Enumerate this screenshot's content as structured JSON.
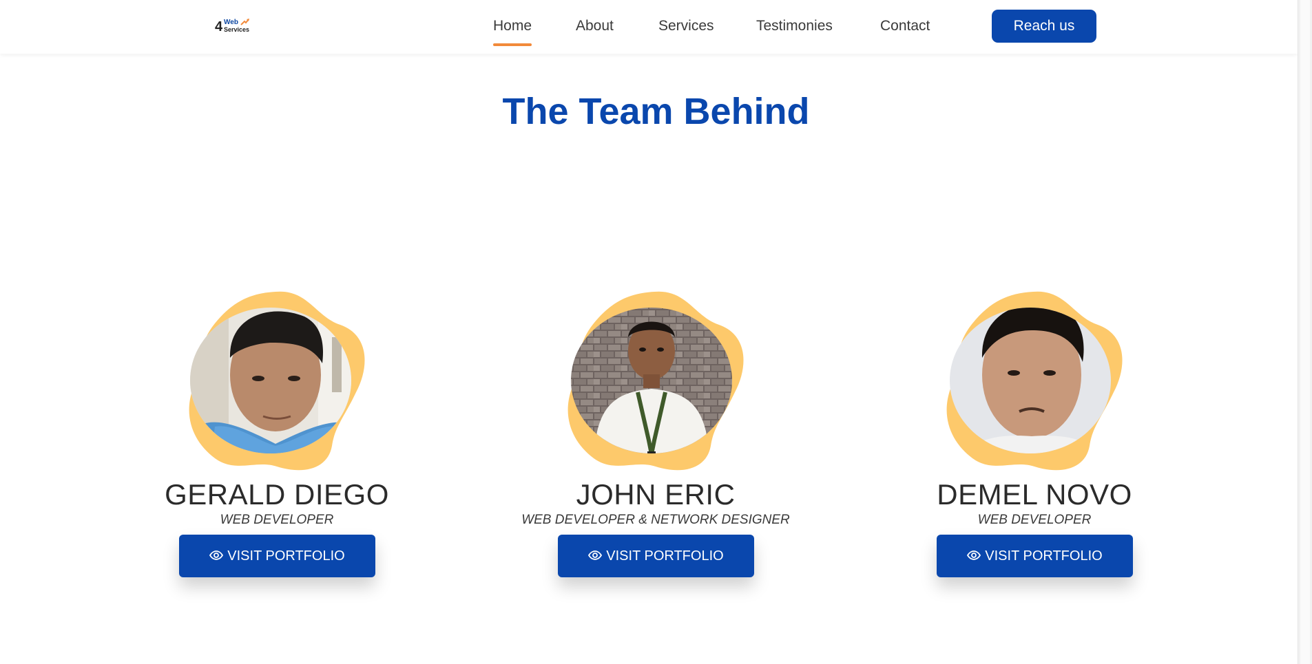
{
  "header": {
    "logo": {
      "number": "4",
      "line1": "Web",
      "line2": "Services"
    },
    "nav": [
      {
        "label": "Home",
        "active": true
      },
      {
        "label": "About",
        "active": false
      },
      {
        "label": "Services",
        "active": false
      },
      {
        "label": "Testimonies",
        "active": false
      },
      {
        "label": "Contact",
        "active": false
      }
    ],
    "cta_label": "Reach us"
  },
  "section": {
    "title": "The Team Behind"
  },
  "team": [
    {
      "name": "GERALD DIEGO",
      "role": "WEB DEVELOPER",
      "button_label": "VISIT PORTFOLIO"
    },
    {
      "name": "JOHN ERIC",
      "role": "WEB DEVELOPER & NETWORK DESIGNER",
      "button_label": "VISIT PORTFOLIO"
    },
    {
      "name": "DEMEL NOVO",
      "role": "WEB DEVELOPER",
      "button_label": "VISIT PORTFOLIO"
    }
  ],
  "colors": {
    "primary": "#0a47ad",
    "accent_underline": "#f28a3a",
    "blob": "#fdc96b"
  },
  "icons": {
    "button_icon": "eye-icon"
  }
}
